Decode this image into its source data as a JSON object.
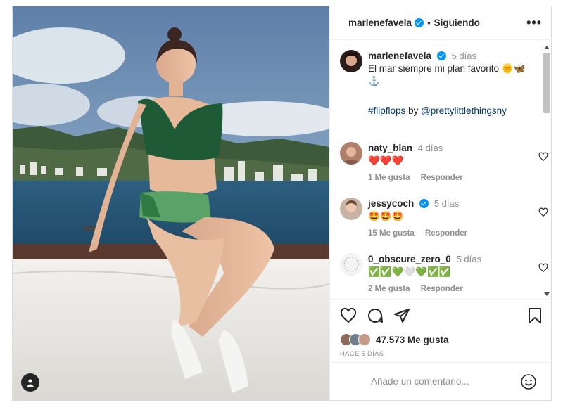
{
  "post": {
    "author": "marlenefavela",
    "follow_status": "Siguiendo",
    "separator": "•",
    "more": "•••"
  },
  "caption": {
    "author": "marlenefavela",
    "time": "5 días",
    "text": "El mar siempre mi plan favorito 🌞🦋 ⚓",
    "hashtag": "#flipflops",
    "by": "by",
    "mention": "@prettylittlethingsny"
  },
  "comments": [
    {
      "user": "naty_blan",
      "time": "4 días",
      "text": "❤️❤️❤️",
      "likes": "1 Me gusta",
      "reply": "Responder",
      "verified": false
    },
    {
      "user": "jessycoch",
      "time": "5 días",
      "text": "🤩🤩🤩",
      "likes": "15 Me gusta",
      "reply": "Responder",
      "verified": true
    },
    {
      "user": "0_obscure_zero_0",
      "time": "5 días",
      "text": "✅✅💚🤍💚✅✅",
      "likes": "2 Me gusta",
      "reply": "Responder",
      "verified": false
    }
  ],
  "stats": {
    "likes": "47.573 Me gusta",
    "posted": "HACE 5 DÍAS"
  },
  "composer": {
    "placeholder": "Añade un comentario..."
  },
  "icons": [
    "user-tag-icon",
    "verified-icon",
    "heart-icon",
    "comment-icon",
    "share-icon",
    "save-icon",
    "emoji-icon"
  ],
  "colors": {
    "verified": "#0095f6",
    "link": "#00376b",
    "muted": "#8e8e8e"
  }
}
